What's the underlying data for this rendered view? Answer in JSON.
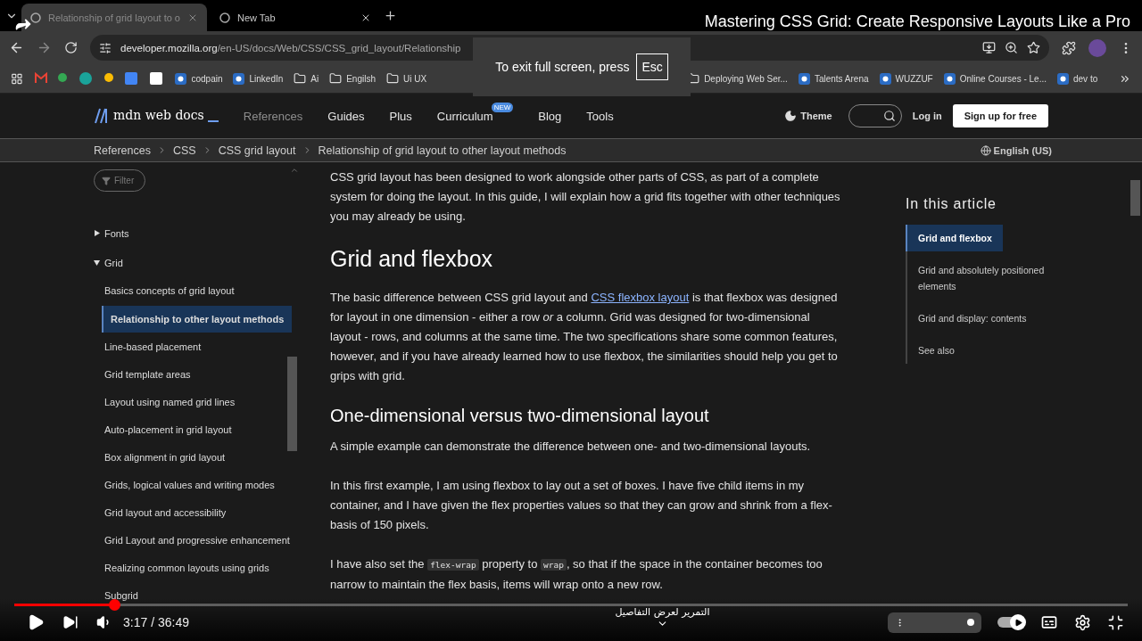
{
  "video": {
    "title": "Mastering CSS Grid: Create Responsive Layouts Like a Pro",
    "time": "3:17 / 36:49",
    "progress": {
      "level": 0.09
    },
    "scroll_hint": "التمرير لعرض التفاصيل",
    "autoplay": {
      "on": true
    },
    "exit_hint": {
      "text": "To exit full screen, press",
      "key": "Esc"
    }
  },
  "browser": {
    "tabs": [
      {
        "title": "Relationship of grid layout to o",
        "selected": true
      },
      {
        "title": "New Tab",
        "selected": false
      }
    ],
    "url": {
      "host": "developer.mozilla.org",
      "path": "/en-US/docs/Web/CSS/CSS_grid_layout/Relationship"
    },
    "bookmarks": [
      {
        "kind": "site",
        "label": "codpain"
      },
      {
        "kind": "site",
        "label": "LinkedIn"
      },
      {
        "kind": "folder",
        "label": "Ai"
      },
      {
        "kind": "folder",
        "label": "Engilsh"
      },
      {
        "kind": "folder",
        "label": "Ui UX"
      },
      {
        "kind": "folder",
        "label": "Deploying Web Ser..."
      },
      {
        "kind": "site",
        "label": "Talents Arena"
      },
      {
        "kind": "site",
        "label": "WUZZUF"
      },
      {
        "kind": "site",
        "label": "Online Courses - Le..."
      },
      {
        "kind": "site",
        "label": "dev to"
      }
    ]
  },
  "mdn": {
    "logo": "mdn web docs",
    "nav": [
      {
        "label": "References",
        "muted": true
      },
      {
        "label": "Guides",
        "muted": false
      },
      {
        "label": "Plus",
        "muted": false
      },
      {
        "label": "Curriculum",
        "muted": false,
        "badge": "NEW"
      },
      {
        "label": "Blog",
        "muted": false
      },
      {
        "label": "Tools",
        "muted": false
      }
    ],
    "theme": "Theme",
    "login": "Log in",
    "signup": "Sign up for free",
    "breadcrumbs": [
      "References",
      "CSS",
      "CSS grid layout",
      "Relationship of grid layout to other layout methods"
    ],
    "language": "English (US)"
  },
  "sidebar": {
    "filter": "Filter",
    "tree": [
      {
        "label": "Fonts",
        "expanded": false
      },
      {
        "label": "Grid",
        "expanded": true,
        "children": [
          {
            "label": "Basics concepts of grid layout",
            "selected": false
          },
          {
            "label": "Relationship to other layout methods",
            "selected": true
          },
          {
            "label": "Line-based placement",
            "selected": false
          },
          {
            "label": "Grid template areas",
            "selected": false
          },
          {
            "label": "Layout using named grid lines",
            "selected": false
          },
          {
            "label": "Auto-placement in grid layout",
            "selected": false
          },
          {
            "label": "Box alignment in grid layout",
            "selected": false
          },
          {
            "label": "Grids, logical values and writing modes",
            "selected": false
          },
          {
            "label": "Grid layout and accessibility",
            "selected": false
          },
          {
            "label": "Grid Layout and progressive enhancement",
            "selected": false
          },
          {
            "label": "Realizing common layouts using grids",
            "selected": false
          },
          {
            "label": "Subgrid",
            "selected": false
          }
        ]
      }
    ]
  },
  "article": [
    {
      "kind": "p",
      "parts": [
        {
          "kind": "text",
          "text": "CSS grid layout has been designed to work alongside other parts of CSS, as part of a complete system for doing the layout. In this guide, I will explain how a grid fits together with other techniques you may already be using."
        }
      ]
    },
    {
      "kind": "h2",
      "text": "Grid and flexbox"
    },
    {
      "kind": "p",
      "parts": [
        {
          "kind": "text",
          "text": "The basic difference between CSS grid layout and "
        },
        {
          "kind": "link",
          "text": "CSS flexbox layout"
        },
        {
          "kind": "text",
          "text": " is that flexbox was designed for layout in one dimension - either a row *or* a column. Grid was designed for two-dimensional layout - rows, and columns at the same time. The two specifications share some common features, however, and if you have already learned how to use flexbox, the similarities should help you get to grips with grid."
        }
      ]
    },
    {
      "kind": "h3",
      "text": "One-dimensional versus two-dimensional layout"
    },
    {
      "kind": "p",
      "parts": [
        {
          "kind": "text",
          "text": "A simple example can demonstrate the difference between one- and two-dimensional layouts."
        }
      ]
    },
    {
      "kind": "p",
      "parts": [
        {
          "kind": "text",
          "text": "In this first example, I am using flexbox to lay out a set of boxes. I have five child items in my container, and I have given the flex properties values so that they can grow and shrink from a flex-basis of 150 pixels."
        }
      ]
    },
    {
      "kind": "p",
      "parts": [
        {
          "kind": "text",
          "text": "I have also set the "
        },
        {
          "kind": "code",
          "text": "flex-wrap"
        },
        {
          "kind": "text",
          "text": " property to "
        },
        {
          "kind": "code",
          "text": "wrap"
        },
        {
          "kind": "text",
          "text": ", so that if the space in the container becomes too narrow to maintain the flex basis, items will wrap onto a new row."
        }
      ]
    }
  ],
  "toc": {
    "title": "In this article",
    "items": [
      {
        "label": "Grid and flexbox",
        "selected": true
      },
      {
        "label": "Grid and absolutely positioned elements",
        "selected": false
      },
      {
        "label": "Grid and display: contents",
        "selected": false
      },
      {
        "label": "See also",
        "selected": false
      }
    ]
  }
}
